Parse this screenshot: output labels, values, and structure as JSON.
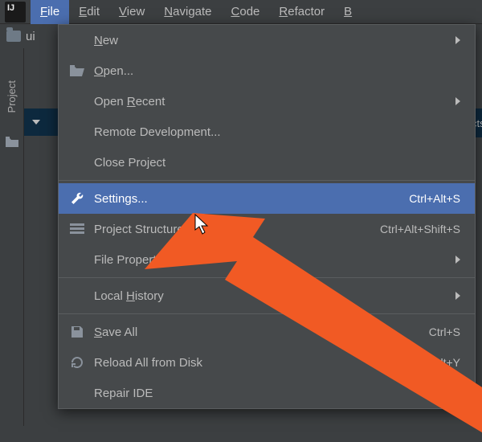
{
  "menubar": {
    "items": [
      {
        "label": "File",
        "mn": "F",
        "rest": "ile",
        "active": true
      },
      {
        "label": "Edit",
        "mn": "E",
        "rest": "dit"
      },
      {
        "label": "View",
        "mn": "V",
        "rest": "iew"
      },
      {
        "label": "Navigate",
        "mn": "N",
        "rest": "avigate"
      },
      {
        "label": "Code",
        "mn": "C",
        "rest": "ode"
      },
      {
        "label": "Refactor",
        "mn": "R",
        "rest": "efactor"
      },
      {
        "label": "B",
        "mn": "B",
        "rest": ""
      }
    ]
  },
  "breadcrumb": {
    "proj": "ui"
  },
  "left_rail": {
    "label": "Project"
  },
  "right_edge": "cts",
  "file_menu": {
    "items": [
      {
        "label": "New",
        "mn": "N",
        "rest": "ew",
        "icon": "",
        "shortcut": "",
        "submenu": true
      },
      {
        "label": "Open...",
        "mn": "O",
        "rest": "pen...",
        "icon": "open-folder-icon",
        "shortcut": "",
        "submenu": false
      },
      {
        "label": "Open Recent",
        "pre": "Open ",
        "mn": "R",
        "rest": "ecent",
        "icon": "",
        "shortcut": "",
        "submenu": true
      },
      {
        "label": "Remote Development...",
        "icon": "",
        "shortcut": "",
        "submenu": false
      },
      {
        "label": "Close Project",
        "icon": "",
        "shortcut": "",
        "submenu": false
      },
      {
        "sep": true
      },
      {
        "label": "Settings...",
        "icon": "wrench-icon",
        "shortcut": "Ctrl+Alt+S",
        "submenu": false,
        "highlight": true
      },
      {
        "label": "Project Structure...",
        "pre": "Project Struc",
        "mn": "",
        "rest": "ture...",
        "icon": "project-structure-icon",
        "shortcut": "Ctrl+Alt+Shift+S",
        "submenu": false
      },
      {
        "label": "File Properties",
        "icon": "",
        "shortcut": "",
        "submenu": true
      },
      {
        "sep": true
      },
      {
        "label": "Local History",
        "pre": "Local ",
        "mn": "H",
        "rest": "istory",
        "icon": "",
        "shortcut": "",
        "submenu": true
      },
      {
        "sep": true
      },
      {
        "label": "Save All",
        "mn": "S",
        "rest": "ave All",
        "icon": "save-icon",
        "shortcut": "Ctrl+S",
        "submenu": false
      },
      {
        "label": "Reload All from Disk",
        "icon": "reload-icon",
        "shortcut": "Ctrl+Alt+Y",
        "submenu": false
      },
      {
        "label": "Repair IDE",
        "icon": "",
        "shortcut": "",
        "submenu": false
      }
    ]
  },
  "colors": {
    "accent": "#4b6eaf",
    "arrow": "#f15a24"
  }
}
